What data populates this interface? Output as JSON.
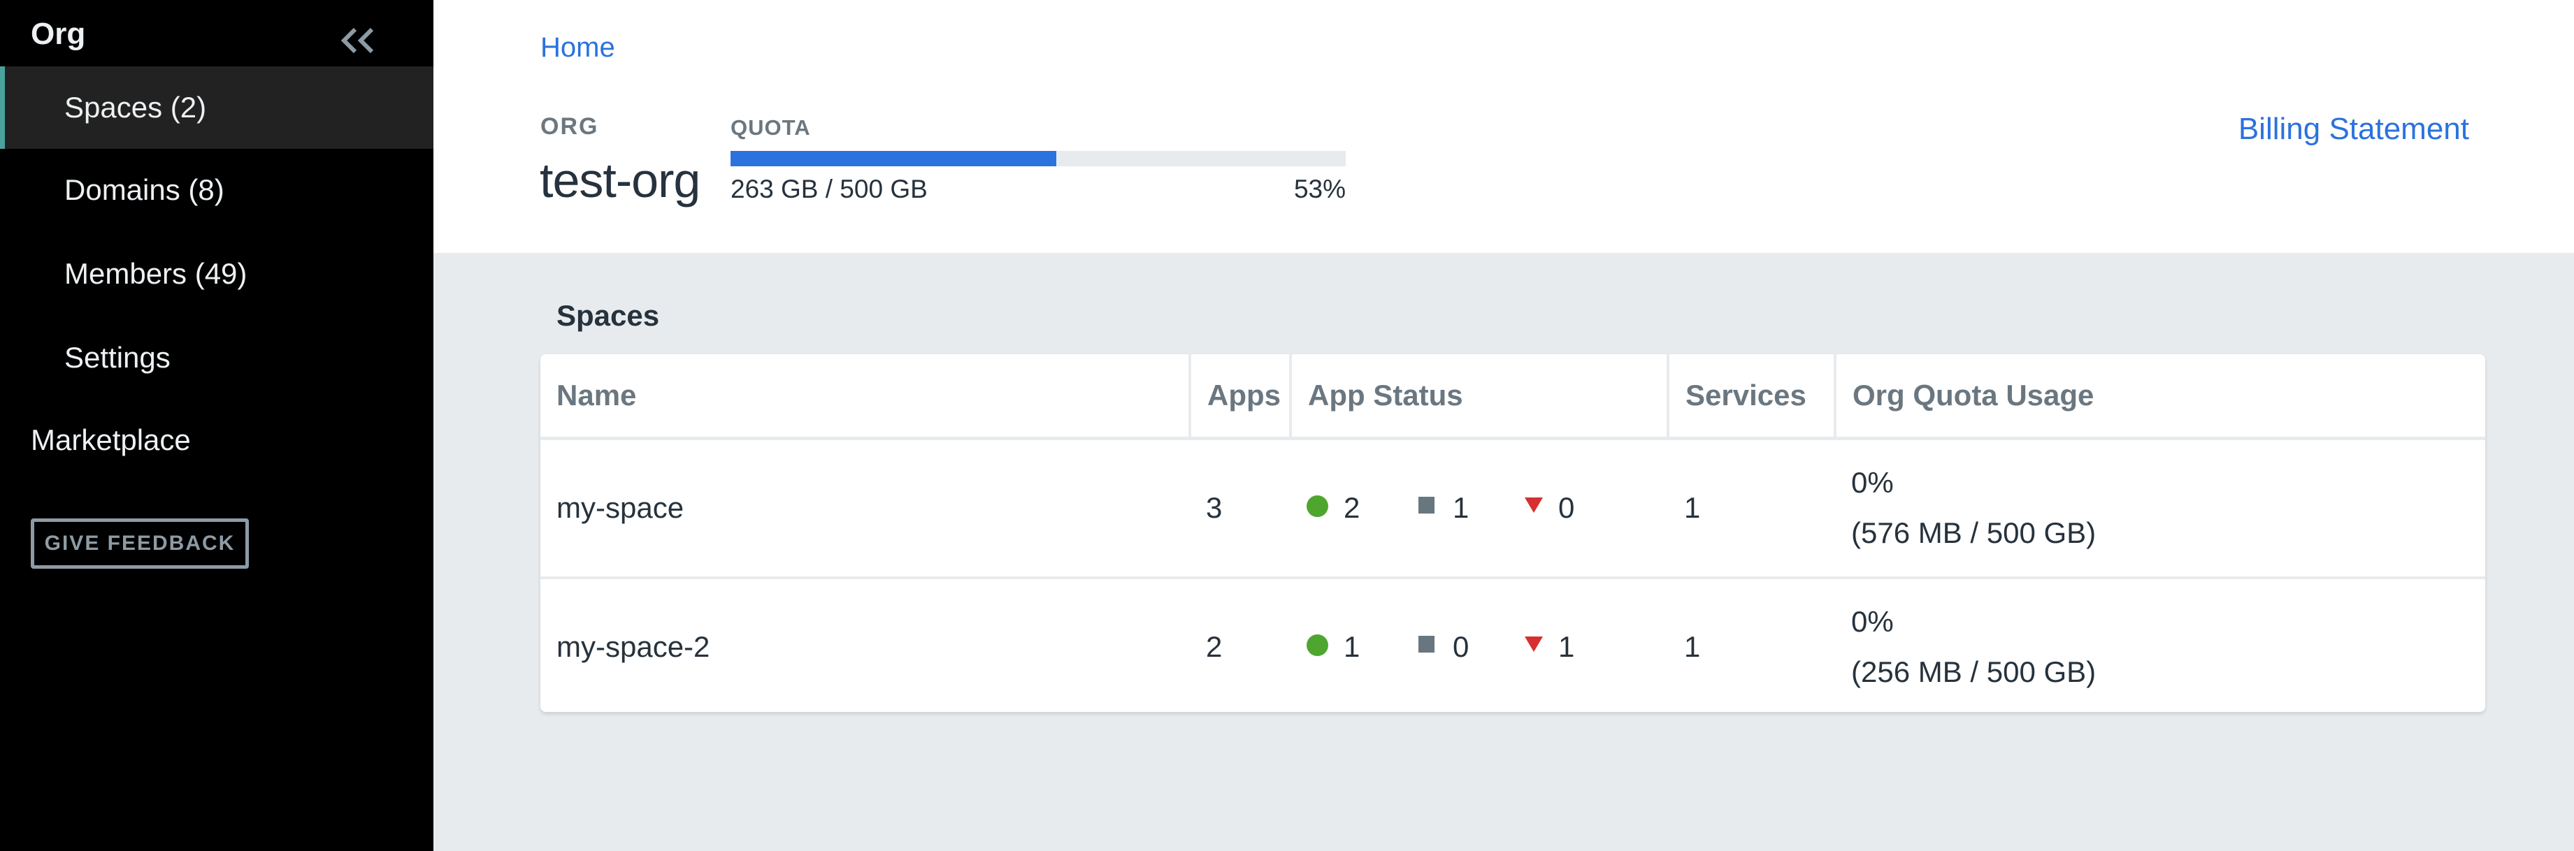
{
  "sidebar": {
    "title": "Org",
    "collapse_icon": "double-chevron-left-icon",
    "items": [
      {
        "label": "Spaces (2)",
        "active": true
      },
      {
        "label": "Domains (8)",
        "active": false
      },
      {
        "label": "Members (49)",
        "active": false
      },
      {
        "label": "Settings",
        "active": false
      }
    ],
    "marketplace_label": "Marketplace",
    "feedback_label": "GIVE FEEDBACK"
  },
  "header": {
    "breadcrumb": [
      "Home"
    ],
    "org_label": "ORG",
    "org_name": "test-org",
    "quota": {
      "label": "QUOTA",
      "used": "263 GB",
      "total": "500 GB",
      "text": "263 GB / 500 GB",
      "percent_text": "53%",
      "percent": 53
    },
    "billing_link": "Billing Statement"
  },
  "colors": {
    "accent": "#2b72de",
    "active_indicator": "#4aa39b",
    "running": "#4fa62f",
    "stopped": "#687680",
    "crashed": "#d63031"
  },
  "spaces": {
    "title": "Spaces",
    "columns": [
      "Name",
      "Apps",
      "App Status",
      "Services",
      "Org Quota Usage"
    ],
    "rows": [
      {
        "name": "my-space",
        "apps": "3",
        "status": {
          "running": "2",
          "stopped": "1",
          "crashed": "0"
        },
        "services": "1",
        "usage_percent": "0%",
        "usage_detail": "(576 MB / 500 GB)"
      },
      {
        "name": "my-space-2",
        "apps": "2",
        "status": {
          "running": "1",
          "stopped": "0",
          "crashed": "1"
        },
        "services": "1",
        "usage_percent": "0%",
        "usage_detail": "(256 MB / 500 GB)"
      }
    ]
  }
}
